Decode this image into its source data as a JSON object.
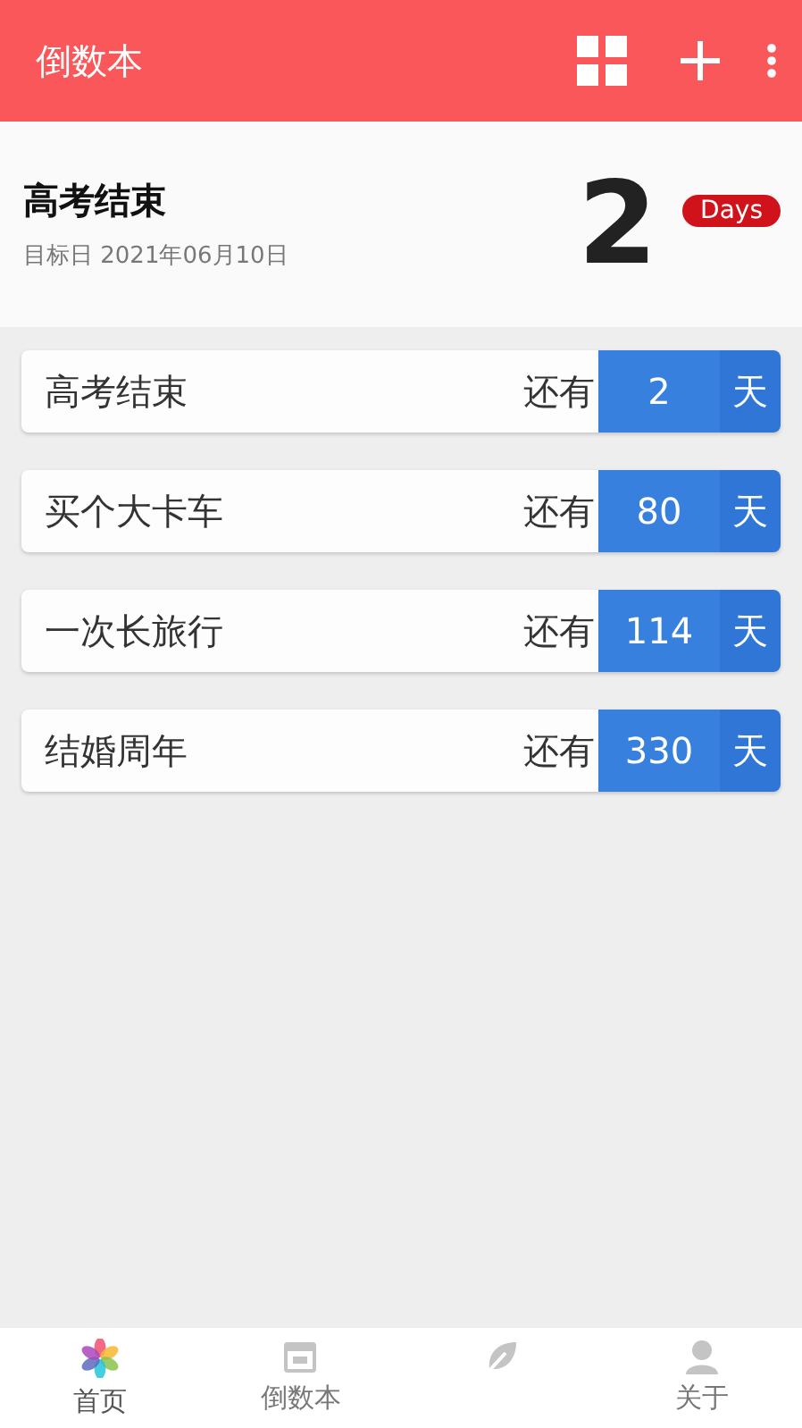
{
  "app_bar": {
    "title": "倒数本"
  },
  "highlight": {
    "title": "高考结束",
    "date": "目标日 2021年06月10日",
    "count": "2",
    "unit": "Days"
  },
  "events": [
    {
      "name": "高考结束",
      "prefix": "还有",
      "days": "2",
      "unit": "天"
    },
    {
      "name": "买个大卡车",
      "prefix": "还有",
      "days": "80",
      "unit": "天"
    },
    {
      "name": "一次长旅行",
      "prefix": "还有",
      "days": "114",
      "unit": "天"
    },
    {
      "name": "结婚周年",
      "prefix": "还有",
      "days": "330",
      "unit": "天"
    }
  ],
  "bottom_nav": [
    {
      "kind": "flower",
      "label": "首页",
      "selected": true
    },
    {
      "kind": "calendar",
      "label": "倒数本",
      "selected": false
    },
    {
      "kind": "leaf",
      "selected": false
    },
    {
      "kind": "person",
      "label": "关于",
      "selected": false
    }
  ]
}
